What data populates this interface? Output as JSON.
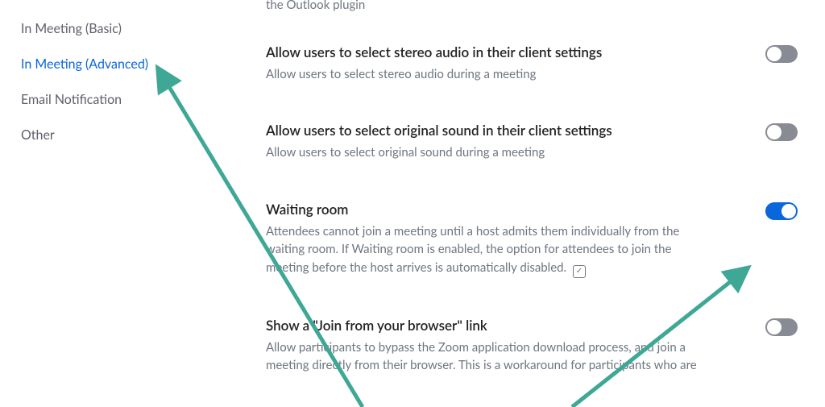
{
  "sidebar": {
    "items": [
      {
        "label": "In Meeting (Basic)",
        "active": false
      },
      {
        "label": "In Meeting (Advanced)",
        "active": true
      },
      {
        "label": "Email Notification",
        "active": false
      },
      {
        "label": "Other",
        "active": false
      }
    ]
  },
  "partial_top_desc": "the Outlook plugin",
  "settings": [
    {
      "title": "Allow users to select stereo audio in their client settings",
      "desc": "Allow users to select stereo audio during a meeting",
      "toggle": false,
      "modified_icon": false
    },
    {
      "title": "Allow users to select original sound in their client settings",
      "desc": "Allow users to select original sound during a meeting",
      "toggle": false,
      "modified_icon": false
    },
    {
      "title": "Waiting room",
      "desc": "Attendees cannot join a meeting until a host admits them individually from the waiting room. If Waiting room is enabled, the option for attendees to join the meeting before the host arrives is automatically disabled.",
      "toggle": true,
      "modified_icon": true
    },
    {
      "title": "Show a \"Join from your browser\" link",
      "desc": "Allow participants to bypass the Zoom application download process, and join a meeting directly from their browser. This is a workaround for participants who are",
      "toggle": false,
      "modified_icon": false
    }
  ],
  "annotation_color": "#3fa796"
}
